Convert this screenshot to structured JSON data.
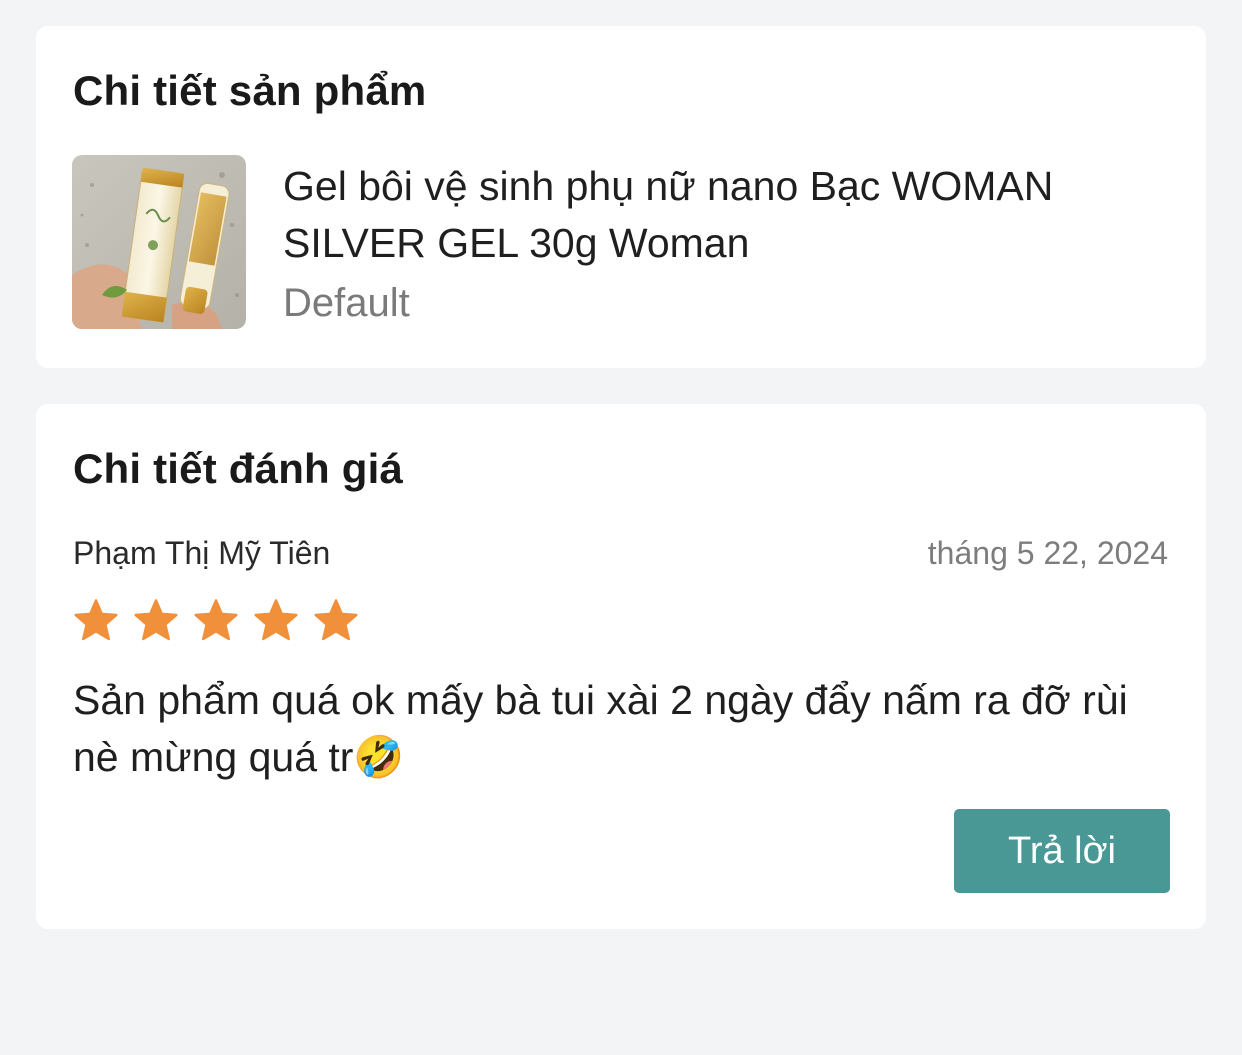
{
  "product_section": {
    "title": "Chi tiết sản phẩm",
    "product": {
      "image_icon": "product-photo",
      "name": "Gel bôi vệ sinh phụ nữ nano Bạc WOMAN SILVER GEL 30g Woman",
      "variant": "Default"
    }
  },
  "review_section": {
    "title": "Chi tiết đánh giá",
    "review": {
      "reviewer": "Phạm Thị Mỹ Tiên",
      "date": "tháng 5 22, 2024",
      "rating": 5,
      "rating_max": 5,
      "text": "Sản phẩm quá ok mấy bà tui xài 2 ngày đẩy nấm ra đỡ rùi nè mừng quá tr🤣"
    },
    "reply_button_label": "Trả lời"
  },
  "colors": {
    "background": "#f3f4f6",
    "card": "#ffffff",
    "star": "#f0903a",
    "button": "#4a9896",
    "muted_text": "#7d7d7d"
  }
}
